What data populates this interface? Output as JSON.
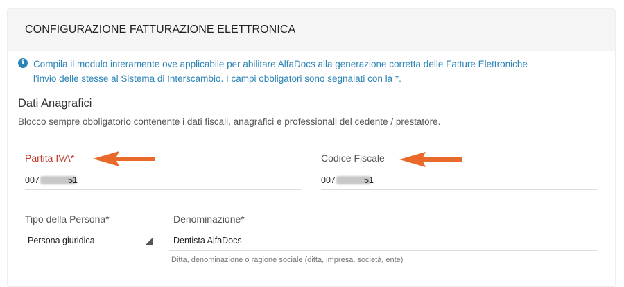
{
  "header": {
    "title": "CONFIGURAZIONE FATTURAZIONE ELETTRONICA"
  },
  "info": {
    "icon": "info-icon",
    "line1": "Compila il modulo interamente ove applicabile per abilitare AlfaDocs alla generazione corretta delle Fatture Elettroniche",
    "line2": "l'invio delle stesse al Sistema di Interscambio. I campi obbligatori sono segnalati con la *."
  },
  "section": {
    "title": "Dati Anagrafici",
    "description": "Blocco sempre obbligatorio contenente i dati fiscali, anagrafici e professionali del cedente / prestatore."
  },
  "fields": {
    "partita_iva": {
      "label": "Partita IVA*",
      "value_start": "007",
      "value_end": "51"
    },
    "codice_fiscale": {
      "label": "Codice Fiscale",
      "value_start": "007",
      "value_end": "51"
    },
    "tipo_persona": {
      "label": "Tipo della Persona*",
      "value": "Persona giuridica"
    },
    "denominazione": {
      "label": "Denominazione*",
      "value": "Dentista AlfaDocs",
      "help": "Ditta, denominazione o ragione sociale (ditta, impresa, società, ente)"
    }
  },
  "annotations": {
    "arrow_color": "#e8692a"
  }
}
